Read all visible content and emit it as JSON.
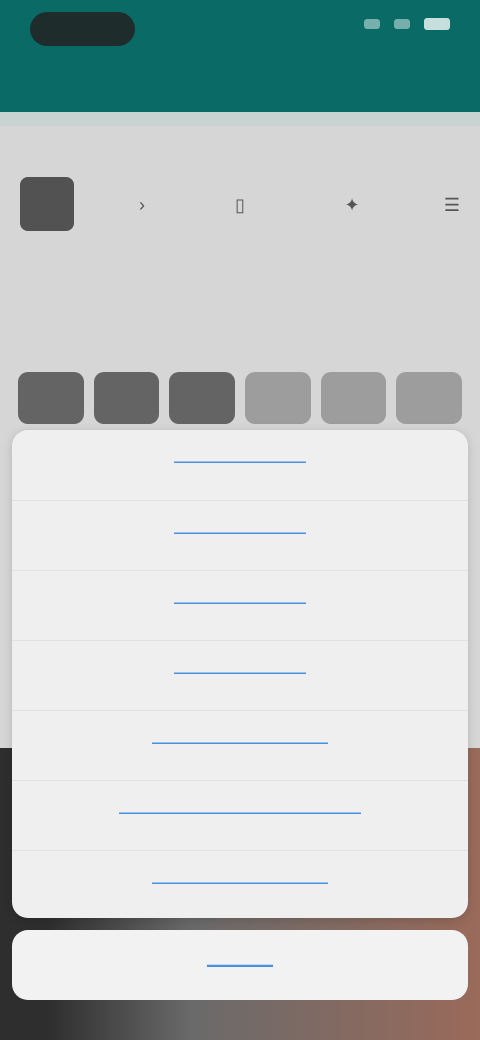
{
  "theme": {
    "primary": "#0A6B66",
    "link_blue": "#4A90E2",
    "sheet_bg": "#EFEFEF"
  },
  "status_bar": {
    "icons": [
      "signal-icon",
      "wifi-icon",
      "battery-icon"
    ]
  },
  "top_row": {
    "icons": [
      "grid-icon",
      "chevron-icon",
      "mic-icon",
      "star-icon",
      "menu-icon"
    ]
  },
  "chips": [
    {
      "label": ""
    },
    {
      "label": ""
    },
    {
      "label": ""
    },
    {
      "label": ""
    },
    {
      "label": ""
    },
    {
      "label": ""
    }
  ],
  "action_sheet": {
    "options": [
      "——————",
      "——————",
      "——————",
      "——————",
      "————————",
      "———————————",
      "————————"
    ],
    "cancel_label": "———"
  }
}
